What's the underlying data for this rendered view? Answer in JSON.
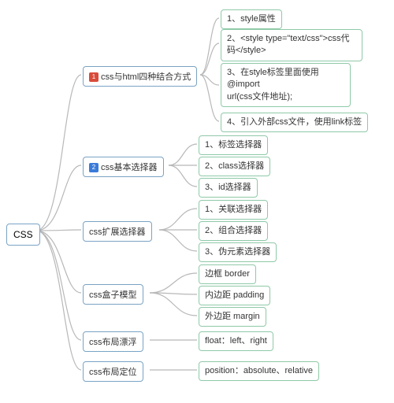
{
  "root": "CSS",
  "branches": [
    {
      "label": "css与html四种结合方式",
      "badge": "1",
      "leaves": [
        "1、style属性",
        "2、<style type=\"text/css\">css代码</style>",
        "3、在style标签里面使用\n@import\nurl(css文件地址);",
        "4、引入外部css文件，使用link标签"
      ]
    },
    {
      "label": "css基本选择器",
      "badge": "2",
      "leaves": [
        "1、标签选择器",
        "2、class选择器",
        "3、id选择器"
      ]
    },
    {
      "label": "css扩展选择器",
      "leaves": [
        "1、关联选择器",
        "2、组合选择器",
        "3、伪元素选择器"
      ]
    },
    {
      "label": "css盒子模型",
      "leaves": [
        "边框 border",
        "内边距 padding",
        "外边距 margin"
      ]
    },
    {
      "label": "css布局漂浮",
      "leaves": [
        "float：left、right"
      ]
    },
    {
      "label": "css布局定位",
      "leaves": [
        "position：absolute、relative"
      ]
    }
  ]
}
